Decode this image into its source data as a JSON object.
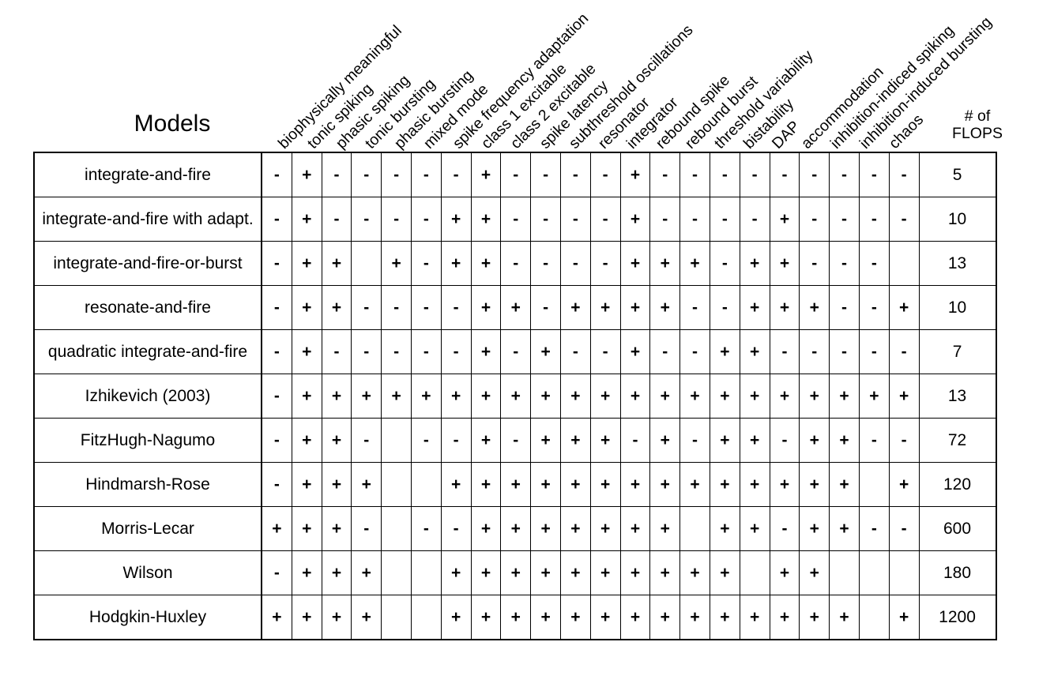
{
  "title": {
    "models_label": "Models",
    "flops_line1": "# of",
    "flops_line2": "FLOPS"
  },
  "columns": [
    "biophysically meaningful",
    "tonic spiking",
    "phasic spiking",
    "tonic bursting",
    "phasic bursting",
    "mixed mode",
    "spike frequency adaptation",
    "class 1 excitable",
    "class 2 excitable",
    "spike latency",
    "subthreshold oscillations",
    "resonator",
    "integrator",
    "rebound spike",
    "rebound burst",
    "threshold variability",
    "bistability",
    "DAP",
    "accommodation",
    "inhibition-indiced spiking",
    "inhibition-induced bursting",
    "chaos"
  ],
  "rows": [
    {
      "model": "integrate-and-fire",
      "marks": [
        "-",
        "+",
        "-",
        "-",
        "-",
        "-",
        "-",
        "+",
        "-",
        "-",
        "-",
        "-",
        "+",
        "-",
        "-",
        "-",
        "-",
        "-",
        "-",
        "-",
        "-",
        "-"
      ],
      "flops": "5"
    },
    {
      "model": "integrate-and-fire with adapt.",
      "marks": [
        "-",
        "+",
        "-",
        "-",
        "-",
        "-",
        "+",
        "+",
        "-",
        "-",
        "-",
        "-",
        "+",
        "-",
        "-",
        "-",
        "-",
        "+",
        "-",
        "-",
        "-",
        "-"
      ],
      "flops": "10"
    },
    {
      "model": "integrate-and-fire-or-burst",
      "marks": [
        "-",
        "+",
        "+",
        "",
        "+",
        "-",
        "+",
        "+",
        "-",
        "-",
        "-",
        "-",
        "+",
        "+",
        "+",
        "-",
        "+",
        "+",
        "-",
        "-",
        "-",
        ""
      ],
      "flops": "13"
    },
    {
      "model": "resonate-and-fire",
      "marks": [
        "-",
        "+",
        "+",
        "-",
        "-",
        "-",
        "-",
        "+",
        "+",
        "-",
        "+",
        "+",
        "+",
        "+",
        "-",
        "-",
        "+",
        "+",
        "+",
        "-",
        "-",
        "+"
      ],
      "flops": "10"
    },
    {
      "model": "quadratic integrate-and-fire",
      "marks": [
        "-",
        "+",
        "-",
        "-",
        "-",
        "-",
        "-",
        "+",
        "-",
        "+",
        "-",
        "-",
        "+",
        "-",
        "-",
        "+",
        "+",
        "-",
        "-",
        "-",
        "-",
        "-"
      ],
      "flops": "7"
    },
    {
      "model": "Izhikevich (2003)",
      "marks": [
        "-",
        "+",
        "+",
        "+",
        "+",
        "+",
        "+",
        "+",
        "+",
        "+",
        "+",
        "+",
        "+",
        "+",
        "+",
        "+",
        "+",
        "+",
        "+",
        "+",
        "+",
        "+"
      ],
      "flops": "13"
    },
    {
      "model": "FitzHugh-Nagumo",
      "marks": [
        "-",
        "+",
        "+",
        "-",
        "",
        "-",
        "-",
        "+",
        "-",
        "+",
        "+",
        "+",
        "-",
        "+",
        "-",
        "+",
        "+",
        "-",
        "+",
        "+",
        "-",
        "-"
      ],
      "flops": "72"
    },
    {
      "model": "Hindmarsh-Rose",
      "marks": [
        "-",
        "+",
        "+",
        "+",
        "",
        "",
        "+",
        "+",
        "+",
        "+",
        "+",
        "+",
        "+",
        "+",
        "+",
        "+",
        "+",
        "+",
        "+",
        "+",
        "",
        "+"
      ],
      "flops": "120"
    },
    {
      "model": "Morris-Lecar",
      "marks": [
        "+",
        "+",
        "+",
        "-",
        "",
        "-",
        "-",
        "+",
        "+",
        "+",
        "+",
        "+",
        "+",
        "+",
        "",
        "+",
        "+",
        "-",
        "+",
        "+",
        "-",
        "-"
      ],
      "flops": "600"
    },
    {
      "model": "Wilson",
      "marks": [
        "-",
        "+",
        "+",
        "+",
        "",
        "",
        "+",
        "+",
        "+",
        "+",
        "+",
        "+",
        "+",
        "+",
        "+",
        "+",
        "",
        "+",
        "+",
        "",
        "",
        ""
      ],
      "flops": "180"
    },
    {
      "model": "Hodgkin-Huxley",
      "marks": [
        "+",
        "+",
        "+",
        "+",
        "",
        "",
        "+",
        "+",
        "+",
        "+",
        "+",
        "+",
        "+",
        "+",
        "+",
        "+",
        "+",
        "+",
        "+",
        "+",
        "",
        "+"
      ],
      "flops": "1200"
    }
  ]
}
